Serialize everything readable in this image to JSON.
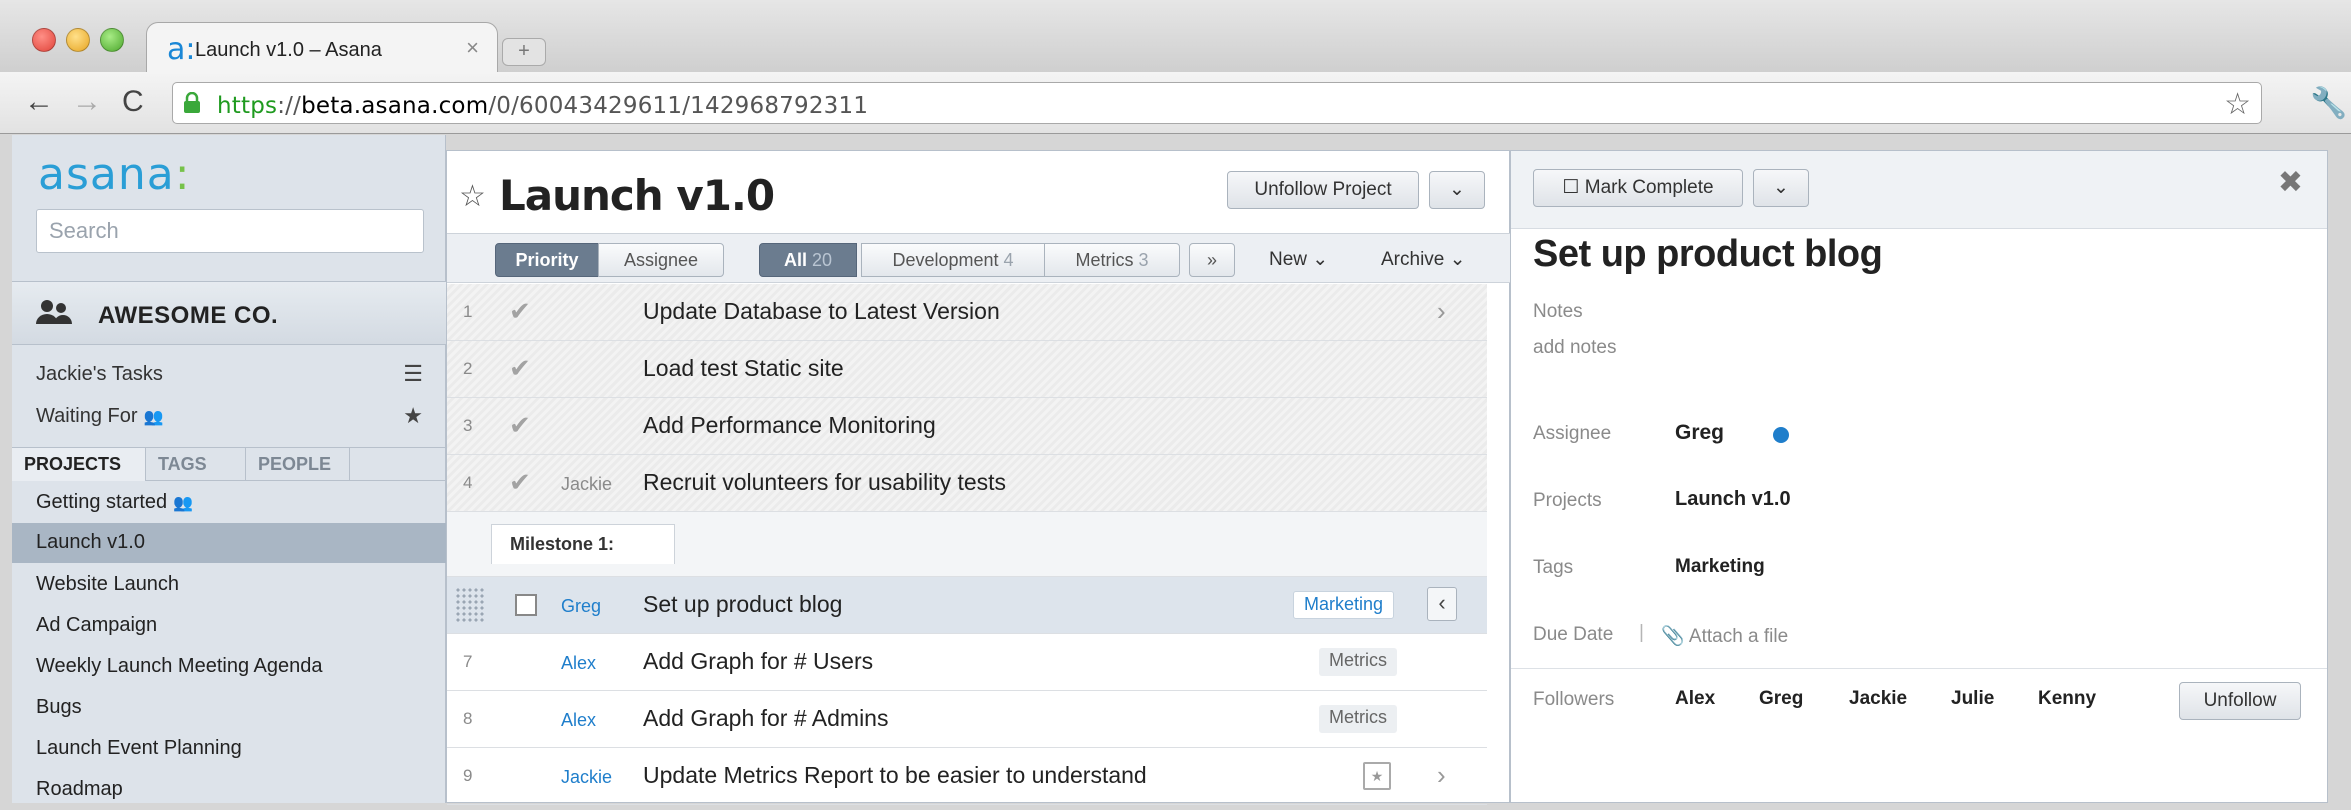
{
  "browser": {
    "tab_title": "Launch v1.0 – Asana",
    "tab_favicon": "a:",
    "tab_close": "×",
    "newtab": "+",
    "url_scheme": "https",
    "url_sep": "://",
    "url_host": "beta.asana.com",
    "url_path": "/0/60043429611/142968792311",
    "back": "←",
    "forward": "→",
    "reload": "C",
    "star": "☆",
    "wrench": "🔧"
  },
  "sidebar": {
    "logo_text": "asana",
    "logo_dots": ":",
    "search_placeholder": "Search",
    "workspace": "AWESOME CO.",
    "my_tasks": "Jackie's Tasks",
    "waiting_for": "Waiting For",
    "tabs": [
      "PROJECTS",
      "TAGS",
      "PEOPLE"
    ],
    "projects": [
      "Getting started",
      "Launch v1.0",
      "Website Launch",
      "Ad Campaign",
      "Weekly Launch Meeting Agenda",
      "Bugs",
      "Launch Event Planning",
      "Roadmap"
    ]
  },
  "center": {
    "title": "Launch  v1.0",
    "unfollow_label": "Unfollow Project",
    "sort": {
      "priority": "Priority",
      "assignee": "Assignee"
    },
    "filters": [
      {
        "label": "All",
        "count": "20"
      },
      {
        "label": "Development",
        "count": "4"
      },
      {
        "label": "Metrics",
        "count": "3"
      }
    ],
    "more": "»",
    "new_label": "New",
    "archive_label": "Archive",
    "milestone": "Milestone 1:",
    "rows": [
      {
        "num": "1",
        "assignee": "",
        "task": "Update Database to Latest Version"
      },
      {
        "num": "2",
        "assignee": "",
        "task": "Load test Static site"
      },
      {
        "num": "3",
        "assignee": "",
        "task": "Add Performance Monitoring"
      },
      {
        "num": "4",
        "assignee": "Jackie",
        "task": "Recruit volunteers for usability tests"
      },
      {
        "num": "",
        "assignee": "Greg",
        "task": "Set up product blog",
        "tag": "Marketing"
      },
      {
        "num": "7",
        "assignee": "Alex",
        "task": "Add Graph for # Users",
        "tag": "Metrics"
      },
      {
        "num": "8",
        "assignee": "Alex",
        "task": "Add Graph for # Admins",
        "tag": "Metrics"
      },
      {
        "num": "9",
        "assignee": "Jackie",
        "task": "Update Metrics Report to be easier to understand"
      }
    ]
  },
  "detail": {
    "mark_complete": "Mark Complete",
    "title": "Set up product blog",
    "notes_label": "Notes",
    "notes_placeholder": "add notes",
    "assignee_label": "Assignee",
    "assignee": "Greg",
    "projects_label": "Projects",
    "project": "Launch v1.0",
    "tags_label": "Tags",
    "tag": "Marketing",
    "due_label": "Due Date",
    "divider": "|",
    "attach": "Attach a file",
    "followers_label": "Followers",
    "followers": [
      "Alex",
      "Greg",
      "Jackie",
      "Julie",
      "Kenny"
    ],
    "unfollow": "Unfollow"
  },
  "colors": {
    "accent_blue": "#1f7ecb",
    "selected_project_bg": "#a9b6c4",
    "segment_on": "#6b7c8f"
  }
}
